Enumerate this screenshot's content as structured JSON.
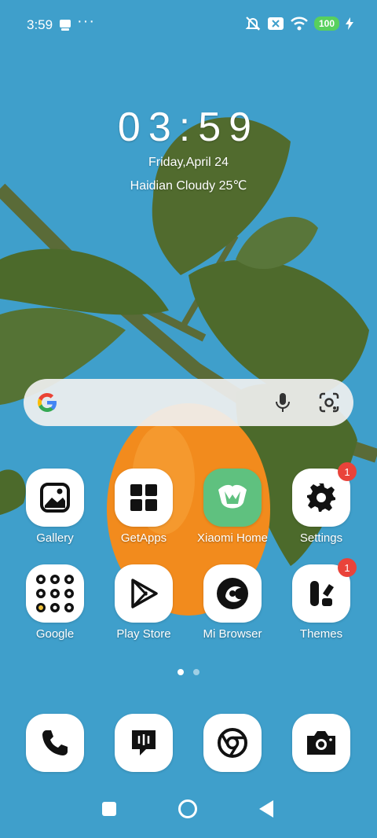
{
  "status": {
    "time": "3:59",
    "more": "···",
    "battery": "100"
  },
  "clock": {
    "time": "03:59",
    "date": "Friday,April 24",
    "weather": "Haidian Cloudy 25℃"
  },
  "apps": [
    {
      "label": "Gallery"
    },
    {
      "label": "GetApps"
    },
    {
      "label": "Xiaomi Home"
    },
    {
      "label": "Settings",
      "badge": "1"
    },
    {
      "label": "Google"
    },
    {
      "label": "Play Store"
    },
    {
      "label": "Mi Browser"
    },
    {
      "label": "Themes",
      "badge": "1"
    }
  ],
  "dock": [
    {
      "icon": "phone-icon"
    },
    {
      "icon": "messages-icon"
    },
    {
      "icon": "chrome-icon"
    },
    {
      "icon": "camera-icon"
    }
  ],
  "colors": {
    "background": "#3f9fcb",
    "badge": "#e9433a",
    "battery": "#58d05d",
    "mi_home": "#5fc17f"
  }
}
